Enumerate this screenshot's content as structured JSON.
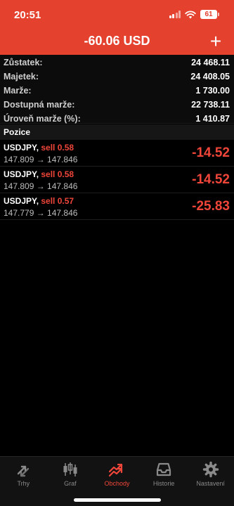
{
  "status": {
    "time": "20:51",
    "battery": "61"
  },
  "header": {
    "title": "-60.06 USD",
    "add_label": "+"
  },
  "account": [
    {
      "label": "Zůstatek:",
      "value": "24 468.11"
    },
    {
      "label": "Majetek:",
      "value": "24 408.05"
    },
    {
      "label": "Marže:",
      "value": "1 730.00"
    },
    {
      "label": "Dostupná marže:",
      "value": "22 738.11"
    },
    {
      "label": "Úroveň marže (%):",
      "value": "1 410.87"
    }
  ],
  "positions_header": "Pozice",
  "positions": [
    {
      "symbol": "USDJPY,",
      "direction": "sell 0.58",
      "prices": "147.809 → 147.846",
      "pl": "-14.52"
    },
    {
      "symbol": "USDJPY,",
      "direction": "sell 0.58",
      "prices": "147.809 → 147.846",
      "pl": "-14.52"
    },
    {
      "symbol": "USDJPY,",
      "direction": "sell 0.57",
      "prices": "147.779 → 147.846",
      "pl": "-25.83"
    }
  ],
  "tabs": [
    {
      "label": "Trhy",
      "icon": "quotes-arrows-icon",
      "active": false
    },
    {
      "label": "Graf",
      "icon": "candlestick-chart-icon",
      "active": false
    },
    {
      "label": "Obchody",
      "icon": "trade-trend-icon",
      "active": true
    },
    {
      "label": "Historie",
      "icon": "history-inbox-icon",
      "active": false
    },
    {
      "label": "Nastavení",
      "icon": "gear-icon",
      "active": false
    }
  ],
  "colors": {
    "accent": "#e5412f",
    "loss": "#f0463a",
    "background": "#000000"
  }
}
